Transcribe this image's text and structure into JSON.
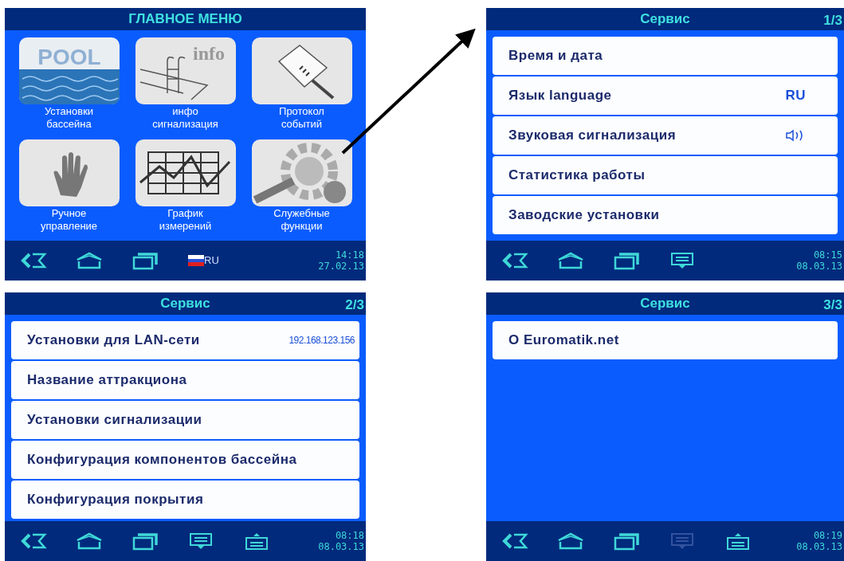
{
  "screens": [
    {
      "kind": "menu",
      "title": "ГЛАВНОЕ МЕНЮ",
      "tiles": [
        {
          "kind": "pool",
          "image_text": "POOL",
          "label": [
            "Установки",
            "бассейна"
          ]
        },
        {
          "kind": "info",
          "image_text": "info",
          "label": [
            "инфо",
            "сигнализация"
          ]
        },
        {
          "kind": "notebook",
          "label": [
            "Протокол",
            "событий"
          ]
        },
        {
          "kind": "hand",
          "label": [
            "Ручное",
            "управление"
          ]
        },
        {
          "kind": "chart",
          "label": [
            "График",
            "измерений"
          ]
        },
        {
          "kind": "gear",
          "label": [
            "Служебные",
            "функции"
          ]
        }
      ],
      "nav": {
        "buttons": [
          {
            "kind": "back",
            "disabled": false
          },
          {
            "kind": "home",
            "disabled": false
          },
          {
            "kind": "recent",
            "disabled": false
          }
        ],
        "language": "RU",
        "time": "14:18",
        "date": "27.02.13"
      }
    },
    {
      "kind": "list",
      "title": "Сервис",
      "page": "1/3",
      "items": [
        {
          "label": "Время и дата"
        },
        {
          "label": "Язык language",
          "value": "RU"
        },
        {
          "label": "Звуковая сигнализация",
          "kind": "speaker"
        },
        {
          "label": "Статистика работы"
        },
        {
          "label": "Заводские установки"
        }
      ],
      "nav": {
        "buttons": [
          {
            "kind": "back",
            "disabled": false
          },
          {
            "kind": "home",
            "disabled": false
          },
          {
            "kind": "recent",
            "disabled": false
          },
          {
            "kind": "menu_down",
            "disabled": false
          }
        ],
        "time": "08:15",
        "date": "08.03.13"
      }
    },
    {
      "kind": "list",
      "title": "Сервис",
      "page": "2/3",
      "items": [
        {
          "label": "Установки для LAN-сети",
          "ip": "192.168.123.156"
        },
        {
          "label": "Название аттракциона"
        },
        {
          "label": "Установки сигнализации"
        },
        {
          "label": "Конфигурация компонентов бассейна"
        },
        {
          "label": "Конфигурация покрытия"
        }
      ],
      "nav": {
        "buttons": [
          {
            "kind": "back",
            "disabled": false
          },
          {
            "kind": "home",
            "disabled": false
          },
          {
            "kind": "recent",
            "disabled": false
          },
          {
            "kind": "menu_down",
            "disabled": false
          },
          {
            "kind": "menu_up",
            "disabled": false
          }
        ],
        "time": "08:18",
        "date": "08.03.13"
      }
    },
    {
      "kind": "list",
      "title": "Сервис",
      "page": "3/3",
      "items": [
        {
          "label": "О Euromatik.net"
        }
      ],
      "nav": {
        "buttons": [
          {
            "kind": "back",
            "disabled": false
          },
          {
            "kind": "home",
            "disabled": false
          },
          {
            "kind": "recent",
            "disabled": false
          },
          {
            "kind": "menu_down",
            "disabled": true
          },
          {
            "kind": "menu_up",
            "disabled": false
          }
        ],
        "time": "08:19",
        "date": "08.03.13"
      }
    }
  ]
}
